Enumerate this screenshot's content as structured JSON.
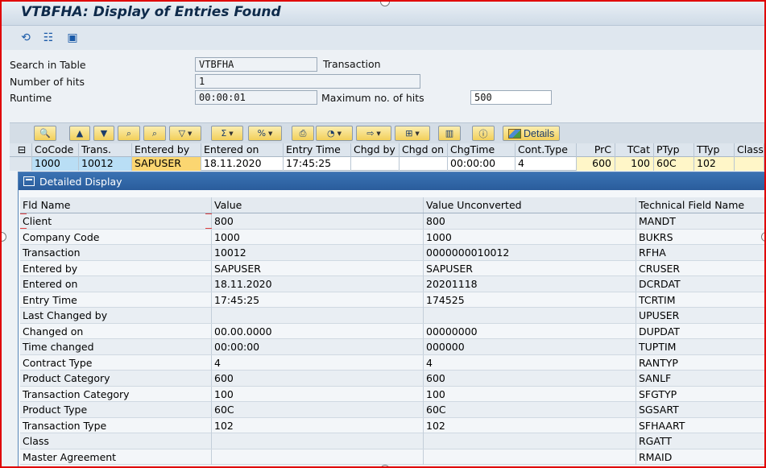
{
  "window": {
    "title": "VTBFHA: Display of Entries Found"
  },
  "appbar": {
    "icons": [
      "refresh-icon",
      "hierarchy-icon",
      "select-all-icon"
    ]
  },
  "selection": {
    "search_label": "Search in Table",
    "search_value": "VTBFHA",
    "search_suffix": "Transaction",
    "hits_label": "Number of hits",
    "hits_value": "1",
    "runtime_label": "Runtime",
    "runtime_value": "00:00:01",
    "maxhits_label": "Maximum no. of hits",
    "maxhits_value": "500"
  },
  "toolbar": {
    "details_label": "Details"
  },
  "grid": {
    "columns": [
      "CoCode",
      "Trans.",
      "Entered by",
      "Entered on",
      "Entry Time",
      "Chgd by",
      "Chgd on",
      "ChgTime",
      "Cont.Type",
      "PrC",
      "TCat",
      "PTyp",
      "TTyp",
      "Class"
    ],
    "row": [
      "1000",
      "10012",
      "SAPUSER",
      "18.11.2020",
      "17:45:25",
      "",
      "",
      "00:00:00",
      "4",
      "600",
      "100",
      "60C",
      "102",
      ""
    ]
  },
  "popup": {
    "title": "Detailed Display",
    "columns": [
      "Fld Name",
      "Value",
      "Value Unconverted",
      "Technical Field Name"
    ],
    "rows": [
      [
        "Client",
        "800",
        "800",
        "MANDT"
      ],
      [
        "Company Code",
        "1000",
        "1000",
        "BUKRS"
      ],
      [
        "Transaction",
        "10012",
        "0000000010012",
        "RFHA"
      ],
      [
        "Entered by",
        "SAPUSER",
        "SAPUSER",
        "CRUSER"
      ],
      [
        "Entered on",
        "18.11.2020",
        "20201118",
        "DCRDAT"
      ],
      [
        "Entry Time",
        "17:45:25",
        "174525",
        "TCRTIM"
      ],
      [
        "Last Changed by",
        "",
        "",
        "UPUSER"
      ],
      [
        "Changed on",
        "00.00.0000",
        "00000000",
        "DUPDAT"
      ],
      [
        "Time changed",
        "00:00:00",
        "000000",
        "TUPTIM"
      ],
      [
        "Contract Type",
        "4",
        "4",
        "RANTYP"
      ],
      [
        "Product Category",
        "600",
        "600",
        "SANLF"
      ],
      [
        "Transaction Category",
        "100",
        "100",
        "SFGTYP"
      ],
      [
        "Product Type",
        "60C",
        "60C",
        "SGSART"
      ],
      [
        "Transaction Type",
        "102",
        "102",
        "SFHAART"
      ],
      [
        "Class",
        "",
        "",
        "RGATT"
      ],
      [
        "Master Agreement",
        "",
        "",
        "RMAID"
      ]
    ]
  }
}
